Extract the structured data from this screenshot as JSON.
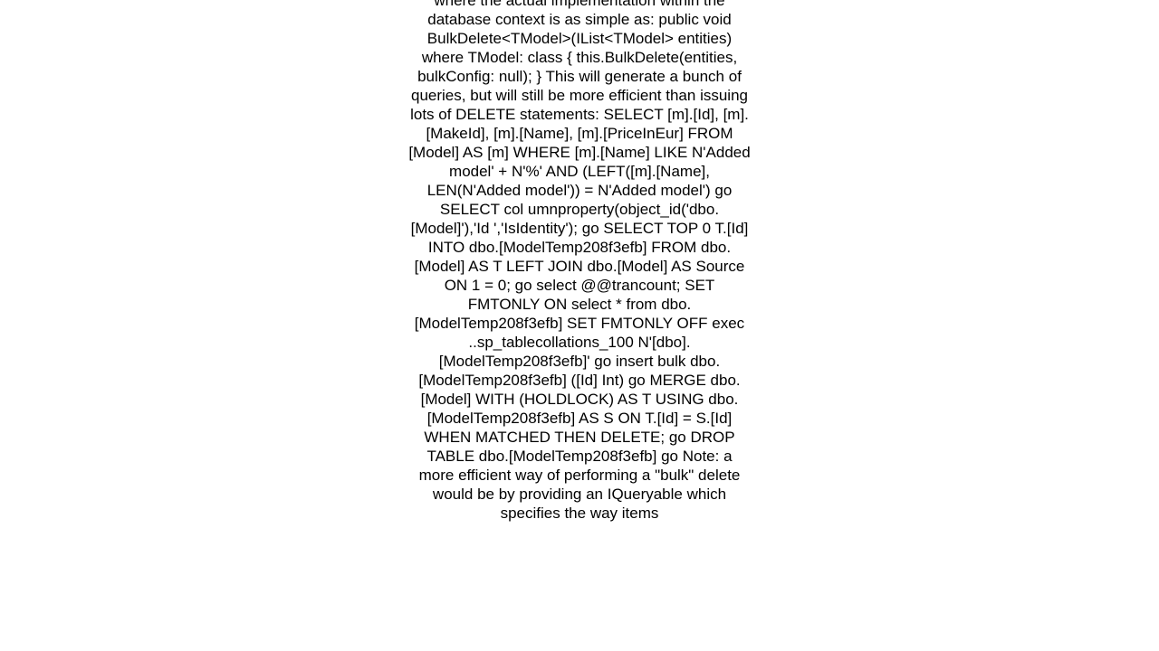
{
  "document": {
    "body_text": "where the actual implementation within the database context is as simple as: public void BulkDelete<TModel>(IList<TModel> entities) where TModel: class { this.BulkDelete(entities, bulkConfig: null); }  This will generate a bunch of queries, but will still be more efficient than issuing lots of DELETE statements: SELECT [m].[Id], [m].[MakeId], [m].[Name], [m].[PriceInEur] FROM [Model] AS [m] WHERE [m].[Name] LIKE N'Added model' + N'%' AND (LEFT([m].[Name], LEN(N'Added model')) = N'Added model') go SELECT col umnproperty(object_id('dbo.[Model]'),'Id ','IsIdentity'); go SELECT TOP 0 T.[Id] INTO dbo.[ModelTemp208f3efb] FROM dbo.[Model] AS T LEFT JOIN dbo.[Model] AS Source ON 1 = 0; go select @@trancount; SET FMTONLY ON select * from dbo.[ModelTemp208f3efb] SET FMTONLY OFF exec ..sp_tablecollations_100 N'[dbo].[ModelTemp208f3efb]' go insert bulk dbo.[ModelTemp208f3efb] ([Id] Int) go MERGE dbo.[Model] WITH (HOLDLOCK) AS T USING dbo.[ModelTemp208f3efb] AS S ON T.[Id] = S.[Id] WHEN MATCHED THEN DELETE; go DROP TABLE dbo.[ModelTemp208f3efb] go  Note: a more efficient way of performing a \"bulk\" delete would be by providing an IQueryable which specifies the way items"
  }
}
